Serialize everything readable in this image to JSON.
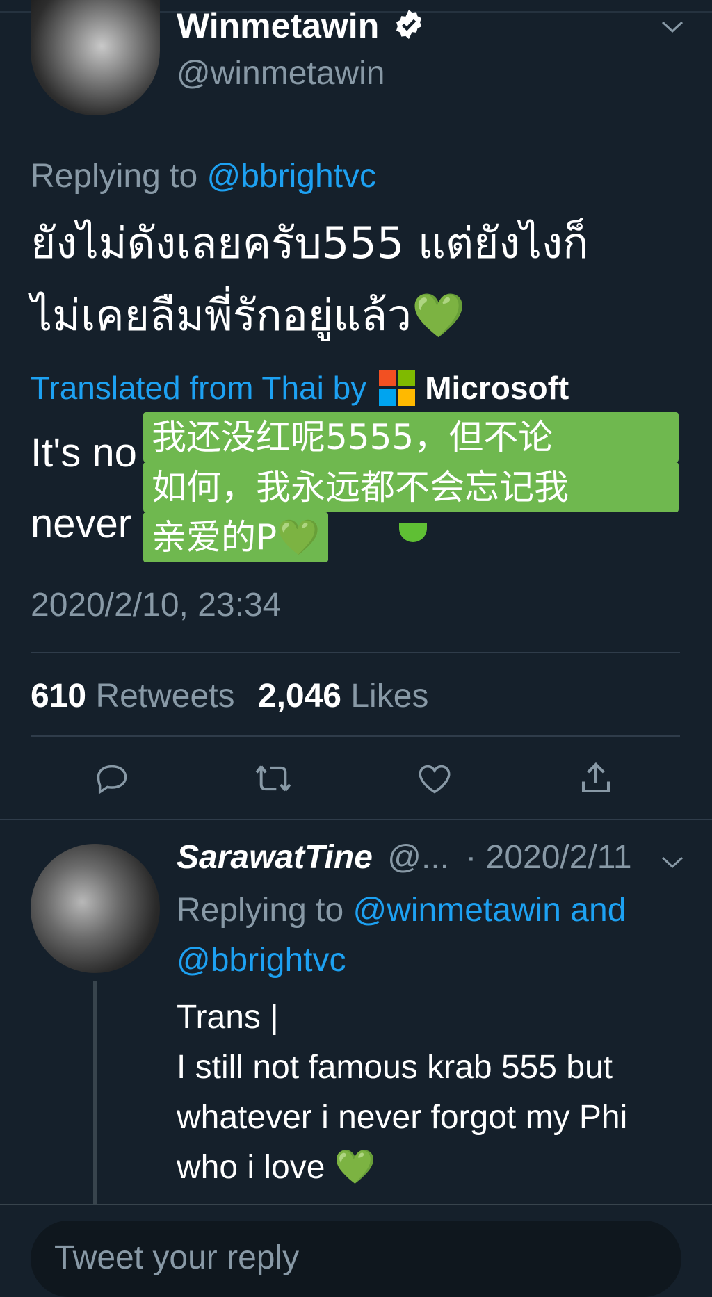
{
  "tweet": {
    "author_name": "Winmetawin",
    "author_handle": "@winmetawin",
    "replying_prefix": "Replying to",
    "replying_to": "@bbrightvc",
    "text_line1": "ยังไม่ดังเลยครับ555 แต่ยังไงก็",
    "text_line2": "ไม่เคยลืมพี่รักอยู่แล้ว💚",
    "translated_label": "Translated from Thai by",
    "translator": "Microsoft",
    "translation_visible_1": "It's no",
    "translation_visible_2": "never",
    "overlay_line1": "我还没红呢5555，但不论",
    "overlay_line2": "如何，我永远都不会忘记我",
    "overlay_line3": "亲爱的P💚",
    "timestamp": "2020/2/10, 23:34",
    "retweets_count": "610",
    "retweets_label": "Retweets",
    "likes_count": "2,046",
    "likes_label": "Likes"
  },
  "reply": {
    "author_name": "SarawatTine",
    "author_handle": "@...",
    "date": "· 2020/2/11",
    "replying_prefix": "Replying to",
    "replying_to_1": "@winmetawin and",
    "replying_to_2": "@bbrightvc",
    "line1": "Trans |",
    "line2": "I still not famous krab 555 but",
    "line3": "whatever i never  forgot my Phi",
    "line4": "who i love 💚"
  },
  "composer": {
    "placeholder": "Tweet your reply"
  },
  "icons": {
    "verified": "verified-badge-icon",
    "chevron": "chevron-down-icon",
    "reply": "reply-icon",
    "retweet": "retweet-icon",
    "like": "heart-icon",
    "share": "share-icon"
  },
  "colors": {
    "background": "#15202b",
    "accent": "#1da1f2",
    "secondary_text": "#8899a6",
    "overlay": "#6fb84f"
  }
}
